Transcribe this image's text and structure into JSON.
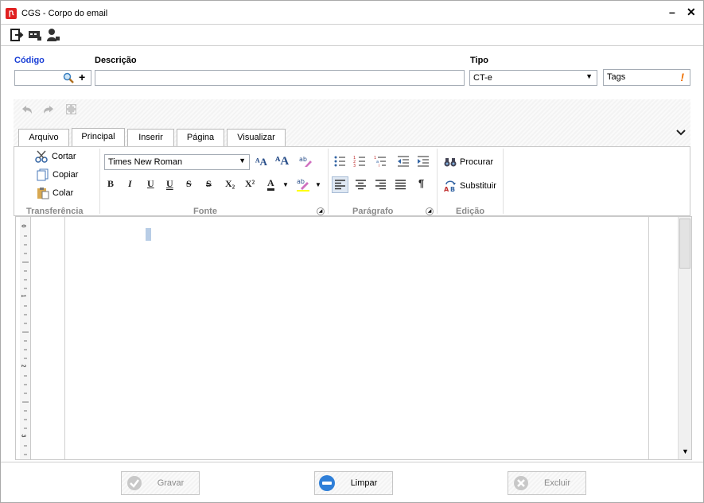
{
  "window": {
    "title": "CGS - Corpo do email",
    "minimize_label": "–",
    "close_label": "✕"
  },
  "toolbar": {
    "icons": [
      "exit-icon",
      "card-icon",
      "user-icon"
    ]
  },
  "form": {
    "codigo_label": "Código",
    "descricao_label": "Descrição",
    "tipo_label": "Tipo",
    "codigo_value": "",
    "descricao_value": "",
    "tipo_value": "CT-e",
    "tags_value": "Tags",
    "plus_label": "+",
    "warn_label": "!",
    "codigo_color": "#1a3fd6"
  },
  "editor_toolbar": {
    "icons": [
      "undo-icon",
      "redo-icon",
      "fullscreen-icon"
    ]
  },
  "tabs": [
    {
      "label": "Arquivo"
    },
    {
      "label": "Principal"
    },
    {
      "label": "Inserir"
    },
    {
      "label": "Página"
    },
    {
      "label": "Visualizar"
    }
  ],
  "ribbon": {
    "clipboard": {
      "cut": "Cortar",
      "copy": "Copiar",
      "paste": "Colar",
      "group": "Transferência"
    },
    "font": {
      "family": "Times New Roman",
      "group": "Fonte",
      "buttons": [
        "B",
        "I",
        "U",
        "U",
        "S",
        "S",
        "X₂",
        "X²",
        "A"
      ]
    },
    "paragraph": {
      "group": "Parágrafo",
      "pilcrow": "¶"
    },
    "editing": {
      "find": "Procurar",
      "replace": "Substituir",
      "group": "Edição"
    }
  },
  "ruler": {
    "marks": [
      "0",
      "1",
      "2",
      "3"
    ]
  },
  "footer": {
    "save": "Gravar",
    "clear": "Limpar",
    "delete": "Excluir"
  }
}
